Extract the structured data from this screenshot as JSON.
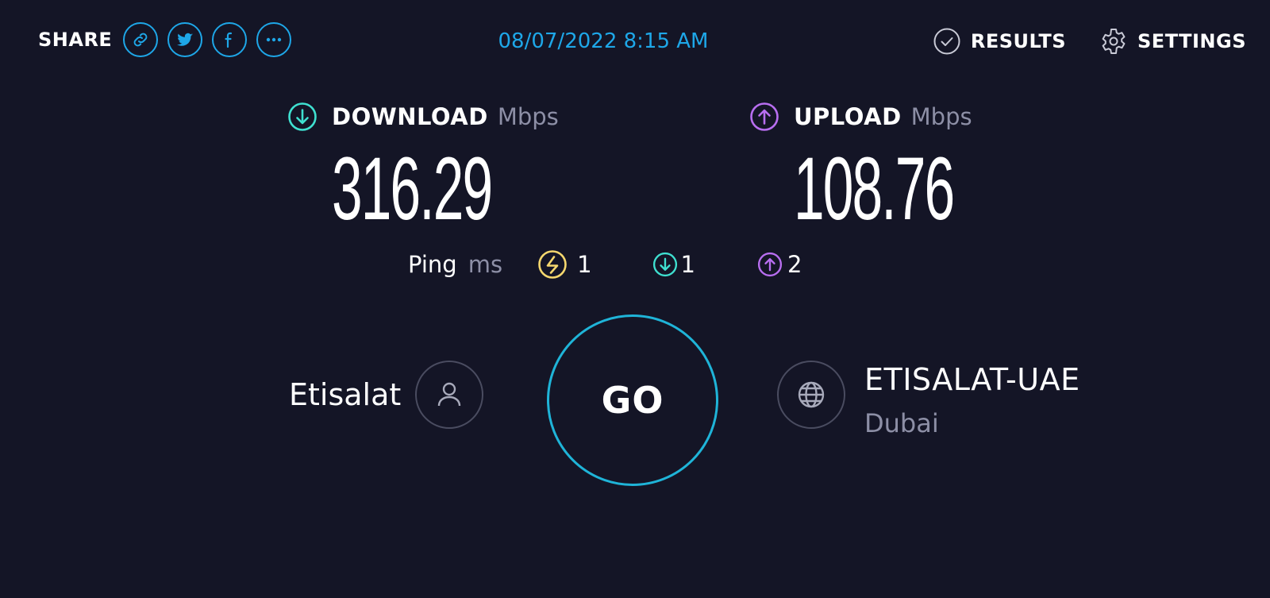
{
  "header": {
    "share_label": "SHARE",
    "share_icons": [
      "link-icon",
      "twitter-icon",
      "facebook-icon",
      "more-icon"
    ],
    "datetime": "08/07/2022 8:15 AM",
    "results_label": "RESULTS",
    "settings_label": "SETTINGS"
  },
  "download": {
    "label": "DOWNLOAD",
    "unit": "Mbps",
    "value": "316.29",
    "color": "#3fe0d0"
  },
  "upload": {
    "label": "UPLOAD",
    "unit": "Mbps",
    "value": "108.76",
    "color": "#b86ef0"
  },
  "ping": {
    "label": "Ping",
    "unit": "ms",
    "idle": "1",
    "download": "1",
    "upload": "2",
    "idle_color": "#f5d76e"
  },
  "isp": {
    "name": "Etisalat"
  },
  "go": {
    "label": "GO"
  },
  "server": {
    "name": "ETISALAT-UAE",
    "location": "Dubai"
  },
  "colors": {
    "accent": "#1ea7e8",
    "background": "#141526"
  }
}
